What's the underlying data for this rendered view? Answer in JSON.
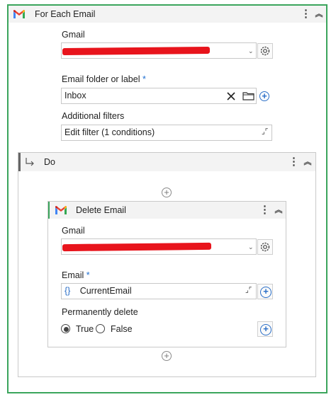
{
  "outer": {
    "title": "For Each Email",
    "gmail_label": "Gmail",
    "folder_label": "Email folder or label",
    "folder_required": "*",
    "folder_value": "Inbox",
    "filters_label": "Additional filters",
    "filters_value": "Edit filter (1 conditions)"
  },
  "do": {
    "title": "Do"
  },
  "inner": {
    "title": "Delete Email",
    "gmail_label": "Gmail",
    "email_label": "Email",
    "email_required": "*",
    "email_prefix": "{}",
    "email_value": "CurrentEmail",
    "perm_label": "Permanently delete",
    "opt_true": "True",
    "opt_false": "False",
    "selected": "True"
  },
  "colors": {
    "accent_green": "#3ba55c",
    "accent_blue": "#2a6ec7",
    "redaction_red": "#e8141c"
  },
  "icons": [
    "gmail-icon",
    "more-options-icon",
    "collapse-icon",
    "dropdown-caret-icon",
    "gear-icon",
    "clear-icon",
    "folder-icon",
    "add-icon",
    "expand-icon",
    "branch-arrow-icon",
    "variable-braces-icon"
  ]
}
